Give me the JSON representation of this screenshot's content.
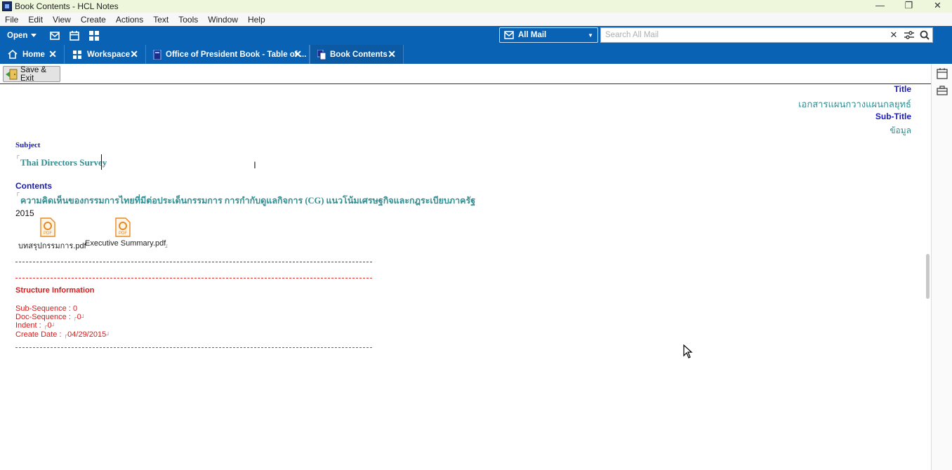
{
  "window": {
    "title": "Book Contents - HCL Notes"
  },
  "menu": [
    "File",
    "Edit",
    "View",
    "Create",
    "Actions",
    "Text",
    "Tools",
    "Window",
    "Help"
  ],
  "toolbar": {
    "open_label": "Open",
    "mail_scope": "All Mail",
    "search_placeholder": "Search All Mail"
  },
  "tabs": [
    {
      "label": "Home"
    },
    {
      "label": "Workspace"
    },
    {
      "label": "Office of President Book - Table of ..."
    },
    {
      "label": "Book Contents"
    }
  ],
  "actions": {
    "save_exit": "Save & Exit"
  },
  "doc": {
    "title_label": "Title",
    "title_value": "เอกสารแผนกวางแผนกลยุทธ์",
    "subtitle_label": "Sub-Title",
    "subtitle_value": "ข้อมูล",
    "subject_label": "Subject",
    "subject_value": "Thai Directors Survey",
    "contents_label": "Contents",
    "contents_value": "ความคิดเห็นของกรรมการไทยที่มีต่อประเด็นกรรมการ การกำกับดูแลกิจการ (CG) แนวโน้มเศรษฐกิจและกฎระเบียบภาครัฐ",
    "year": "2015",
    "attachments": [
      {
        "name": "บทสรุปกรรมการ.pdf"
      },
      {
        "name": "Executive Summary.pdf"
      }
    ],
    "structure_heading": "Structure Information",
    "sub_sequence_label": "Sub-Sequence :",
    "sub_sequence_value": "0",
    "doc_sequence_label": "Doc-Sequence :",
    "doc_sequence_value": "0",
    "indent_label": "Indent :",
    "indent_value": "0",
    "create_date_label": "Create Date :",
    "create_date_value": "04/29/2015"
  }
}
